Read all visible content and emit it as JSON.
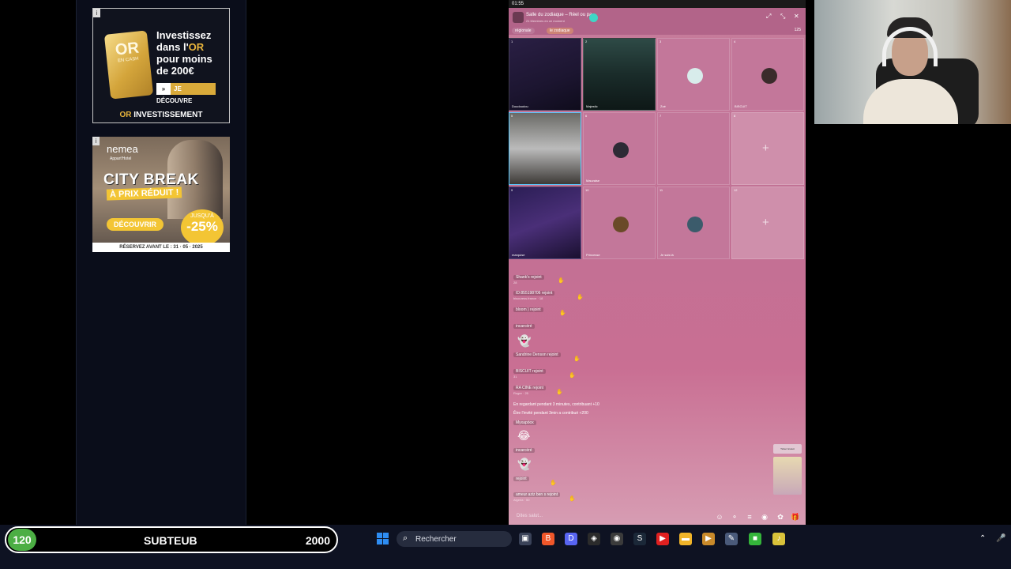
{
  "ads": {
    "or": {
      "badge": "i",
      "gold_brand": "OR",
      "gold_sub": "EN CASH",
      "headline_1": "Investissez",
      "headline_2a": "dans l'",
      "headline_2b": "OR",
      "headline_3": "pour moins",
      "headline_4": "de 200€",
      "button_arrow": "»",
      "button_label": "JE DÉCOUVRE",
      "footer_a": "OR",
      "footer_b": " INVESTISSEMENT"
    },
    "nemea": {
      "badge": "i",
      "logo": "nemea",
      "logo_sub": "Appart'Hotel",
      "city": "CITY BREAK",
      "prix": "À PRIX RÉDUIT !",
      "cta": "DÉCOUVRIR",
      "promo_jusqua": "JUSQU'À",
      "promo_percent": "-25%",
      "reserve": "RÉSERVEZ AVANT LE : 31 · 05 · 2025"
    }
  },
  "phone": {
    "status_time": "01:55",
    "room_name": "Salle du zodiaque – Réel ou pa",
    "room_sub": "21 Membres en ce moment",
    "controls": {
      "minimize": "⤢",
      "expand": "⤡",
      "close": "✕"
    },
    "tags": [
      "régionale",
      "le zodiaque"
    ],
    "viewer_count": "125",
    "tiles": [
      {
        "idx": "1",
        "name": "Doudoudou",
        "kind": "cam1"
      },
      {
        "idx": "2",
        "name": "Majestic",
        "kind": "cam2"
      },
      {
        "idx": "3",
        "name": "Zoé",
        "kind": "avatar"
      },
      {
        "idx": "4",
        "name": "BISCUIT",
        "kind": "avatar"
      },
      {
        "idx": "5",
        "name": "",
        "kind": "cam3"
      },
      {
        "idx": "6",
        "name": "Mauvaise",
        "kind": "avatar"
      },
      {
        "idx": "7",
        "name": "",
        "kind": "empty"
      },
      {
        "idx": "8",
        "name": "",
        "kind": "plus"
      },
      {
        "idx": "9",
        "name": "marquise",
        "kind": "cam4"
      },
      {
        "idx": "10",
        "name": "Princesse",
        "kind": "avatar"
      },
      {
        "idx": "11",
        "name": "Je suis là",
        "kind": "avatar"
      },
      {
        "idx": "12",
        "name": "",
        "kind": "plus"
      }
    ],
    "chat": [
      {
        "text": "Shank's rejoint",
        "sub": "28"
      },
      {
        "text": "ID:855198706 rejoint",
        "sub": "bisouress.france · 18"
      },
      {
        "text": "bloom ) rejoint",
        "sub": ""
      },
      {
        "text": "incarcéré",
        "sub": ""
      },
      {
        "text": "Sandrine Denson rejoint",
        "sub": ""
      },
      {
        "text": "BISCUIT rejoint",
        "sub": "31"
      },
      {
        "text": "RA CINE rejoint",
        "sub": "Roger · 25"
      },
      {
        "text": "En regardant pendant 3 minutes, contribuant +10",
        "sub": ""
      },
      {
        "text": "Être l'invité pendant 3min a contribué +200",
        "sub": ""
      },
      {
        "text": "Myxapóox",
        "sub": ""
      },
      {
        "text": "incarcéré",
        "sub": ""
      },
      {
        "text": "rejoint",
        "sub": ""
      },
      {
        "text": "ameur aziz ben s rejoint",
        "sub": "Algeria · 50"
      }
    ],
    "emoji_1": "👻",
    "emoji_2": "😂",
    "emoji_3": "👻",
    "side_ticket": "Ticket Gratuit",
    "input_placeholder": "Dites salut..."
  },
  "subgoal": {
    "count": "120",
    "label": "SUBTEUB",
    "goal": "2000"
  },
  "taskbar": {
    "search_icon": "⌕",
    "search_label": "Rechercher",
    "apps": [
      {
        "name": "taskview",
        "glyph": "▣",
        "color": "#3a4258"
      },
      {
        "name": "brave",
        "glyph": "B",
        "color": "#f0572a"
      },
      {
        "name": "discord",
        "glyph": "D",
        "color": "#5865f2"
      },
      {
        "name": "app-dark",
        "glyph": "◈",
        "color": "#2b2b2b"
      },
      {
        "name": "obs",
        "glyph": "◉",
        "color": "#3b3b3b"
      },
      {
        "name": "steam",
        "glyph": "S",
        "color": "#1b2838"
      },
      {
        "name": "youtube",
        "glyph": "▶",
        "color": "#e02020"
      },
      {
        "name": "explorer",
        "glyph": "▬",
        "color": "#f0b429"
      },
      {
        "name": "media",
        "glyph": "▶",
        "color": "#c98a2a"
      },
      {
        "name": "notepad",
        "glyph": "✎",
        "color": "#4a5a7a"
      },
      {
        "name": "green-app",
        "glyph": "■",
        "color": "#34b43a"
      },
      {
        "name": "tiktok-live",
        "glyph": "♪",
        "color": "#d9c23a"
      }
    ],
    "tray_chevron": "⌃",
    "tray_mic": "🎤"
  }
}
